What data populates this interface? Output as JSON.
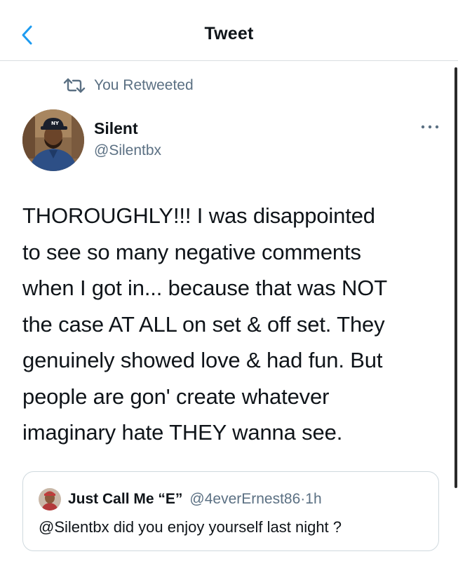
{
  "header": {
    "title": "Tweet",
    "back_icon": "chevron-left-icon"
  },
  "retweet": {
    "icon": "retweet-icon",
    "label": "You Retweeted"
  },
  "tweet": {
    "author_name": "Silent",
    "author_handle": "@Silentbx",
    "more_icon": "more-horizontal-icon",
    "lines": [
      "THOROUGHLY!!! I was disappointed",
      "to see so many negative comments",
      "when I got in... because that was NOT",
      "the case AT ALL on set & off set. They",
      "genuinely showed love & had fun. But",
      "people are gon' create whatever",
      "imaginary hate THEY wanna see."
    ]
  },
  "quoted": {
    "author_name": "Just Call Me “E”",
    "author_handle": "@4everErnest86",
    "separator": "·",
    "time": "1h",
    "text": "@Silentbx did you enjoy yourself last night ?"
  },
  "colors": {
    "accent": "#1d9bf0",
    "secondary_text": "#5b7083",
    "primary_text": "#0f1419",
    "border": "#cfd9de"
  }
}
